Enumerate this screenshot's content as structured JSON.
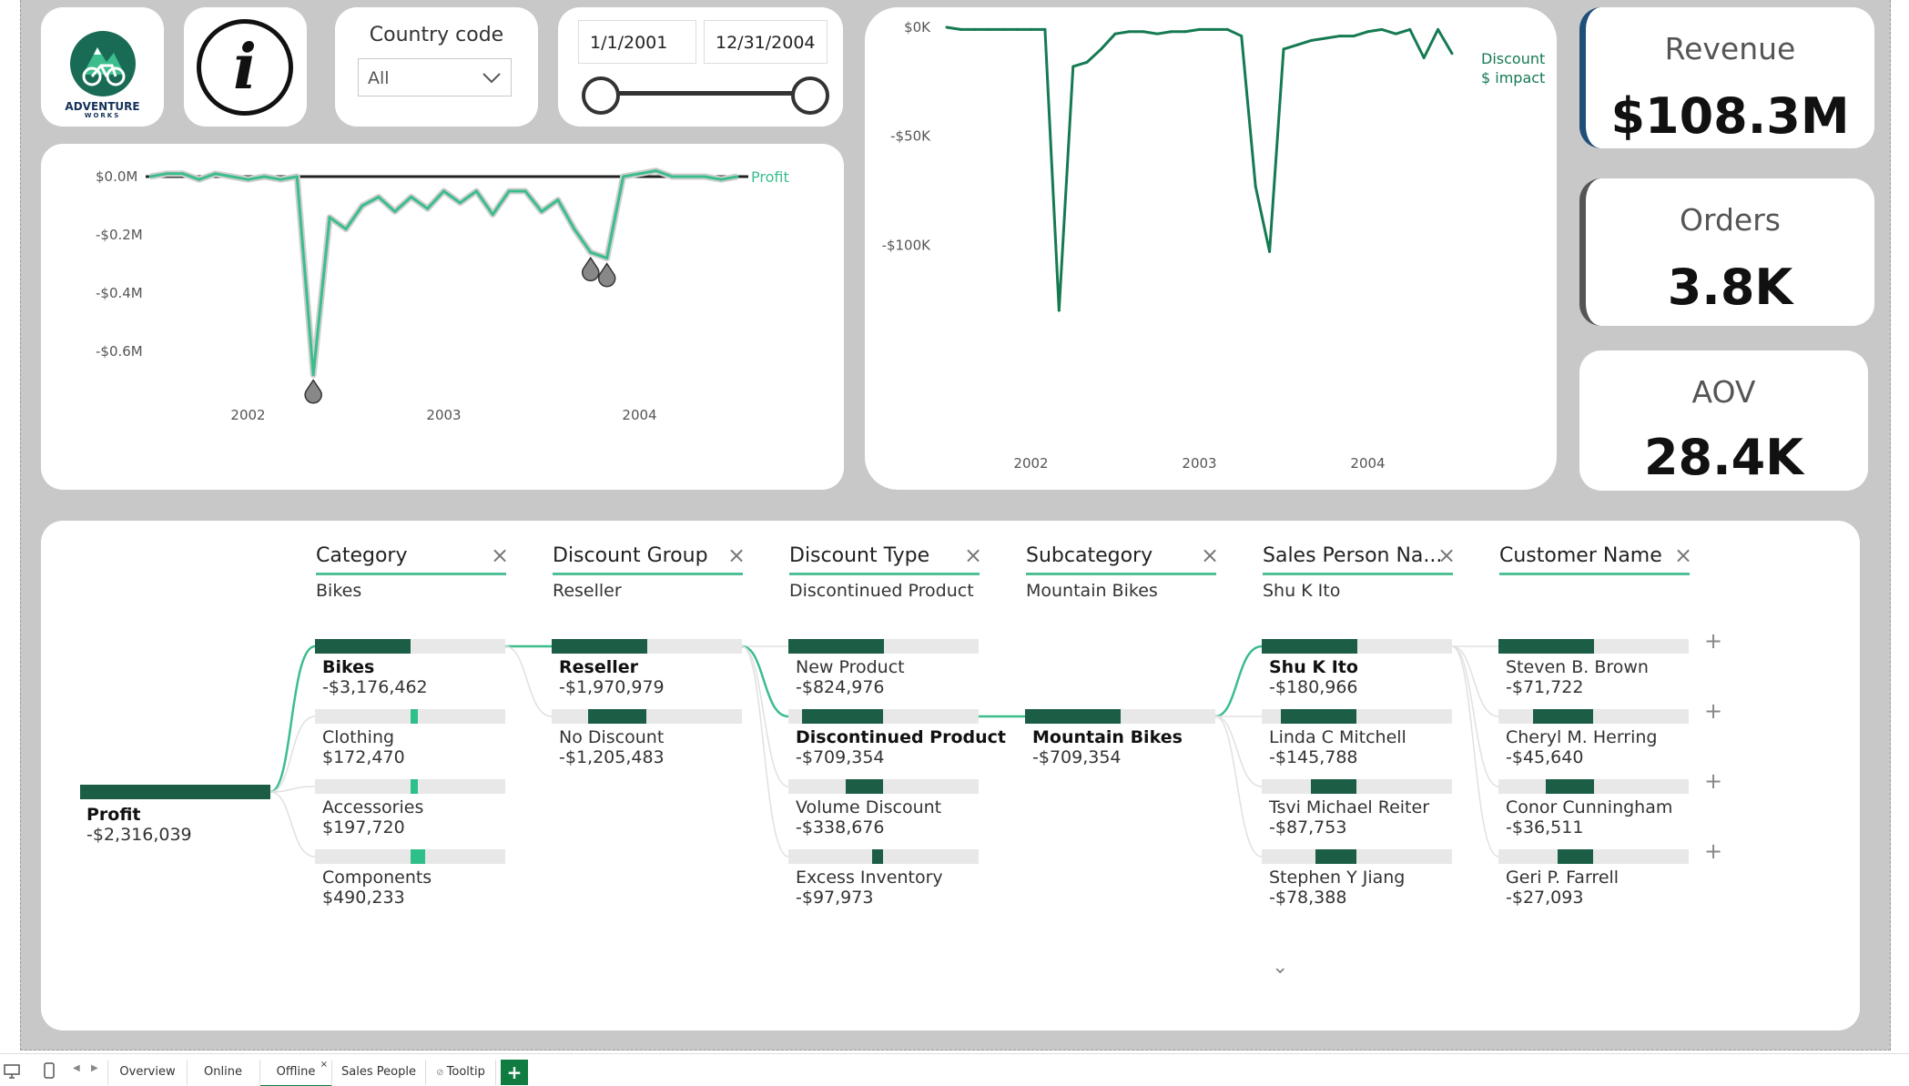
{
  "logo": {
    "text_top": "ADVENTURE",
    "text_bottom": "WORKS"
  },
  "info_icon": "i",
  "slicer_country": {
    "title": "Country code",
    "value": "All"
  },
  "slicer_date": {
    "start": "1/1/2001",
    "end": "12/31/2004"
  },
  "kpi": {
    "revenue": {
      "title": "Revenue",
      "value": "$108.3M"
    },
    "orders": {
      "title": "Orders",
      "value": "3.8K"
    },
    "aov": {
      "title": "AOV",
      "value": "28.4K"
    }
  },
  "chart_data": [
    {
      "type": "line",
      "series": [
        {
          "name": "Profit",
          "color": "#3bbd8c",
          "x": [
            "2001-07",
            "2001-08",
            "2001-09",
            "2001-10",
            "2001-11",
            "2001-12",
            "2002-01",
            "2002-02",
            "2002-03",
            "2002-04",
            "2002-05",
            "2002-06",
            "2002-07",
            "2002-08",
            "2002-09",
            "2002-10",
            "2002-11",
            "2002-12",
            "2003-01",
            "2003-02",
            "2003-03",
            "2003-04",
            "2003-05",
            "2003-06",
            "2003-07",
            "2003-08",
            "2003-09",
            "2003-10",
            "2003-11",
            "2003-12",
            "2004-01",
            "2004-02",
            "2004-03",
            "2004-04",
            "2004-05",
            "2004-06",
            "2004-07"
          ],
          "values": [
            0.0,
            0.01,
            0.01,
            -0.01,
            0.01,
            0.0,
            -0.01,
            0.0,
            -0.01,
            0.0,
            -0.68,
            -0.14,
            -0.18,
            -0.1,
            -0.07,
            -0.12,
            -0.07,
            -0.11,
            -0.05,
            -0.09,
            -0.05,
            -0.13,
            -0.05,
            -0.05,
            -0.12,
            -0.08,
            -0.18,
            -0.26,
            -0.28,
            0.0,
            0.01,
            0.02,
            0.0,
            0.0,
            0.0,
            -0.01,
            0.0
          ]
        }
      ],
      "y_ticks": [
        "$0.0M",
        "-$0.2M",
        "-$0.4M",
        "-$0.6M"
      ],
      "x_ticks": [
        "2002",
        "2003",
        "2004"
      ],
      "ylim": [
        -0.7,
        0.05
      ]
    },
    {
      "type": "line",
      "series": [
        {
          "name": "Discount $ impact",
          "color": "#157a52",
          "x": [
            "2001-07",
            "2001-08",
            "2001-09",
            "2001-10",
            "2001-11",
            "2001-12",
            "2002-01",
            "2002-02",
            "2002-03",
            "2002-04",
            "2002-05",
            "2002-06",
            "2002-07",
            "2002-08",
            "2002-09",
            "2002-10",
            "2002-11",
            "2002-12",
            "2003-01",
            "2003-02",
            "2003-03",
            "2003-04",
            "2003-05",
            "2003-06",
            "2003-07",
            "2003-08",
            "2003-09",
            "2003-10",
            "2003-11",
            "2003-12",
            "2004-01",
            "2004-02",
            "2004-03",
            "2004-04",
            "2004-05",
            "2004-06",
            "2004-07"
          ],
          "values": [
            0,
            -1,
            -1,
            -1,
            -1,
            -1,
            -1,
            -1,
            -130,
            -18,
            -16,
            -10,
            -3,
            -2,
            -2,
            -3,
            -2,
            -2,
            -1,
            -1,
            -1,
            -4,
            -73,
            -103,
            -10,
            -8,
            -6,
            -5,
            -4,
            -4,
            -2,
            -1,
            -3,
            -1,
            -14,
            -1,
            -12
          ]
        }
      ],
      "legend": [
        "Discount",
        "$ impact"
      ],
      "y_ticks": [
        "$0K",
        "-$50K",
        "-$100K"
      ],
      "x_ticks": [
        "2002",
        "2003",
        "2004"
      ],
      "ylim": [
        -135,
        0
      ]
    }
  ],
  "decomp": {
    "root": {
      "name": "Profit",
      "value": "-$2,316,039"
    },
    "fields": [
      {
        "header": "Category",
        "selected": "Bikes"
      },
      {
        "header": "Discount Group",
        "selected": "Reseller"
      },
      {
        "header": "Discount Type",
        "selected": "Discontinued Product"
      },
      {
        "header": "Subcategory",
        "selected": "Mountain Bikes"
      },
      {
        "header": "Sales Person Na...",
        "selected": "Shu K Ito"
      },
      {
        "header": "Customer Name",
        "selected": ""
      }
    ],
    "levels": [
      [
        {
          "name": "Bikes",
          "value": "-$3,176,462",
          "frac": 0.5,
          "sel": true
        },
        {
          "name": "Clothing",
          "value": "$172,470",
          "frac": 0.03,
          "pos": true
        },
        {
          "name": "Accessories",
          "value": "$197,720",
          "frac": 0.035,
          "pos": true
        },
        {
          "name": "Components",
          "value": "$490,233",
          "frac": 0.08,
          "pos": true
        }
      ],
      [
        {
          "name": "Reseller",
          "value": "-$1,970,979",
          "frac": 0.5,
          "sel": true
        },
        {
          "name": "No Discount",
          "value": "-$1,205,483",
          "frac": 0.31
        }
      ],
      [
        {
          "name": "New Product",
          "value": "-$824,976",
          "frac": 0.5
        },
        {
          "name": "Discontinued Product",
          "value": "-$709,354",
          "frac": 0.43,
          "sel": true
        },
        {
          "name": "Volume Discount",
          "value": "-$338,676",
          "frac": 0.2
        },
        {
          "name": "Excess Inventory",
          "value": "-$97,973",
          "frac": 0.06
        }
      ],
      [
        {
          "name": "Mountain Bikes",
          "value": "-$709,354",
          "frac": 0.5,
          "sel": true
        }
      ],
      [
        {
          "name": "Shu K Ito",
          "value": "-$180,966",
          "frac": 0.5,
          "sel": true
        },
        {
          "name": "Linda C Mitchell",
          "value": "-$145,788",
          "frac": 0.4
        },
        {
          "name": "Tsvi Michael Reiter",
          "value": "-$87,753",
          "frac": 0.24
        },
        {
          "name": "Stephen Y Jiang",
          "value": "-$78,388",
          "frac": 0.22
        }
      ],
      [
        {
          "name": "Steven B. Brown",
          "value": "-$71,722",
          "frac": 0.5
        },
        {
          "name": "Cheryl M. Herring",
          "value": "-$45,640",
          "frac": 0.32
        },
        {
          "name": "Conor Cunningham",
          "value": "-$36,511",
          "frac": 0.25
        },
        {
          "name": "Geri P. Farrell",
          "value": "-$27,093",
          "frac": 0.19
        }
      ]
    ]
  },
  "tabs": [
    {
      "label": "Overview"
    },
    {
      "label": "Online"
    },
    {
      "label": "Offline"
    },
    {
      "label": "Sales People"
    },
    {
      "label": "Tooltip"
    }
  ],
  "add_tab_label": "+"
}
